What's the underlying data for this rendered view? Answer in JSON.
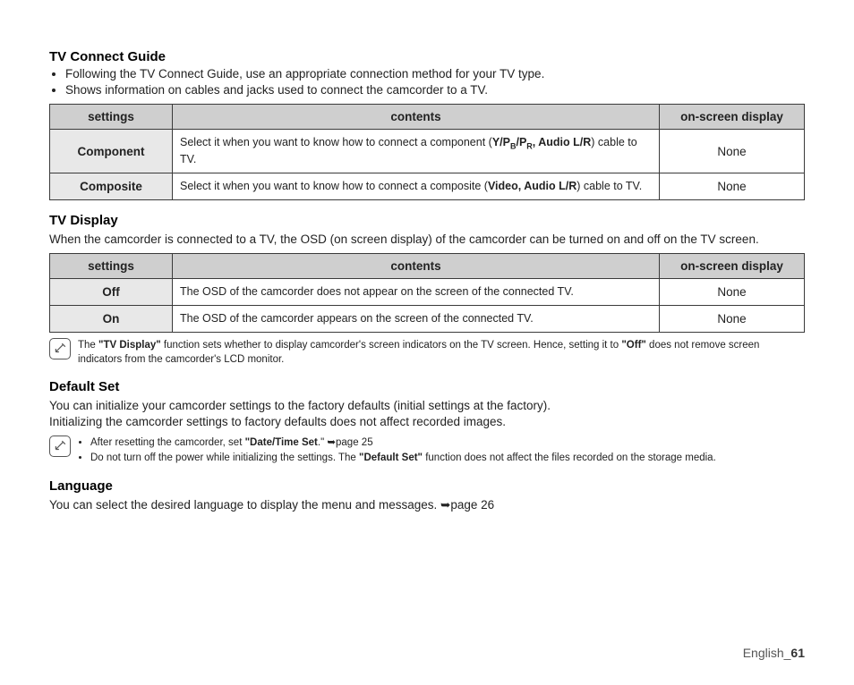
{
  "section1": {
    "title": "TV Connect Guide",
    "bullets": [
      "Following the TV Connect Guide, use an appropriate connection method for your TV type.",
      "Shows information on cables and jacks used to connect the camcorder to a TV."
    ],
    "table": {
      "headers": {
        "settings": "settings",
        "contents": "contents",
        "osd": "on-screen display"
      },
      "rows": [
        {
          "setting": "Component",
          "contents_pre": "Select it when you want to know how to connect a component (",
          "contents_bold": "Y/P",
          "contents_sub1": "B",
          "contents_bold2": "/P",
          "contents_sub2": "R",
          "contents_bold3": ", Audio L/R",
          "contents_post": ") cable to TV.",
          "osd": "None"
        },
        {
          "setting": "Composite",
          "contents_pre": "Select it when you want to know how to connect a composite (",
          "contents_bold": "Video, Audio L/R",
          "contents_post": ") cable to TV.",
          "osd": "None"
        }
      ]
    }
  },
  "section2": {
    "title": "TV Display",
    "body": "When the camcorder is connected to a TV, the OSD (on screen display) of the camcorder can be turned on and off on the TV screen.",
    "table": {
      "headers": {
        "settings": "settings",
        "contents": "contents",
        "osd": "on-screen display"
      },
      "rows": [
        {
          "setting": "Off",
          "contents": "The OSD of the camcorder does not appear on the screen of the connected TV.",
          "osd": "None"
        },
        {
          "setting": "On",
          "contents": "The OSD of the camcorder appears on the screen of the connected TV.",
          "osd": "None"
        }
      ]
    },
    "note_pre": "The ",
    "note_bold1": "\"TV Display\"",
    "note_mid": " function sets whether to display camcorder's screen indicators on the TV screen. Hence, setting it to ",
    "note_bold2": "\"Off\"",
    "note_post": " does not remove screen indicators from the camcorder's LCD monitor."
  },
  "section3": {
    "title": "Default Set",
    "body1": "You can initialize your camcorder settings to the factory defaults (initial settings at the factory).",
    "body2": "Initializing the camcorder settings to factory defaults does not affect recorded images.",
    "note1_pre": "After resetting the camcorder, set ",
    "note1_bold": "\"Date/Time Set",
    "note1_post": ".\" ➥page 25",
    "note2_pre": "Do not turn off the power while initializing the settings. The ",
    "note2_bold": "\"Default Set\"",
    "note2_post": " function does not affect the files recorded on the storage media."
  },
  "section4": {
    "title": "Language",
    "body": "You can select the desired language to display the menu and messages. ➥page 26"
  },
  "footer": {
    "label": "English_",
    "page": "61"
  }
}
